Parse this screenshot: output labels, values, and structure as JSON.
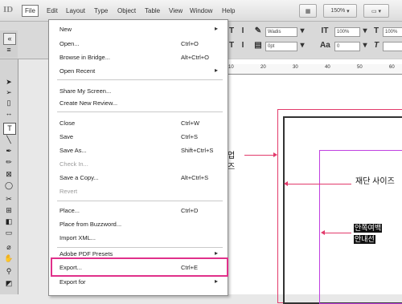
{
  "menubar": {
    "logo": "ID",
    "items": [
      "File",
      "Edit",
      "Layout",
      "Type",
      "Object",
      "Table",
      "View",
      "Window",
      "Help"
    ],
    "zoom": "150%"
  },
  "control": {
    "font_box": "Wadis",
    "pct_box_1": "100%",
    "pct_box_2": "100%",
    "size_box": "0pt",
    "row2_box": "0"
  },
  "ruler": [
    "10",
    "20",
    "30",
    "40",
    "50",
    "60"
  ],
  "dropdown": {
    "items": [
      {
        "label": "New",
        "shortcut": "",
        "submenu": true,
        "disabled": false
      },
      {
        "label": "Open...",
        "shortcut": "Ctrl+O",
        "submenu": false,
        "disabled": false
      },
      {
        "label": "Browse in Bridge...",
        "shortcut": "Alt+Ctrl+O",
        "submenu": false,
        "disabled": false
      },
      {
        "label": "Open Recent",
        "shortcut": "",
        "submenu": true,
        "disabled": false
      },
      {
        "label": "Share My Screen...",
        "shortcut": "",
        "submenu": false,
        "disabled": false
      },
      {
        "label": "Create New Review...",
        "shortcut": "",
        "submenu": false,
        "disabled": false
      },
      {
        "label": "Close",
        "shortcut": "Ctrl+W",
        "submenu": false,
        "disabled": false
      },
      {
        "label": "Save",
        "shortcut": "Ctrl+S",
        "submenu": false,
        "disabled": false
      },
      {
        "label": "Save As...",
        "shortcut": "Shift+Ctrl+S",
        "submenu": false,
        "disabled": false
      },
      {
        "label": "Check In...",
        "shortcut": "",
        "submenu": false,
        "disabled": true
      },
      {
        "label": "Save a Copy...",
        "shortcut": "Alt+Ctrl+S",
        "submenu": false,
        "disabled": false
      },
      {
        "label": "Revert",
        "shortcut": "",
        "submenu": false,
        "disabled": true
      },
      {
        "label": "Place...",
        "shortcut": "Ctrl+D",
        "submenu": false,
        "disabled": false
      },
      {
        "label": "Place from Buzzword...",
        "shortcut": "",
        "submenu": false,
        "disabled": false
      },
      {
        "label": "Import XML...",
        "shortcut": "",
        "submenu": false,
        "disabled": false
      },
      {
        "label": "Adobe PDF Presets",
        "shortcut": "",
        "submenu": true,
        "disabled": false
      },
      {
        "label": "Export...",
        "shortcut": "Ctrl+E",
        "submenu": false,
        "disabled": false
      },
      {
        "label": "Export for",
        "shortcut": "",
        "submenu": true,
        "disabled": false
      }
    ]
  },
  "annotations": {
    "bleed_label": "재단 사이즈",
    "partial_label_line1": "업",
    "partial_label_line2": "즈",
    "margin_label_line1": "안쪽여백",
    "margin_label_line2": "안내선"
  },
  "colors": {
    "highlight": "#e0308a",
    "bleed": "#e23a6b",
    "margin": "#c040e0"
  }
}
